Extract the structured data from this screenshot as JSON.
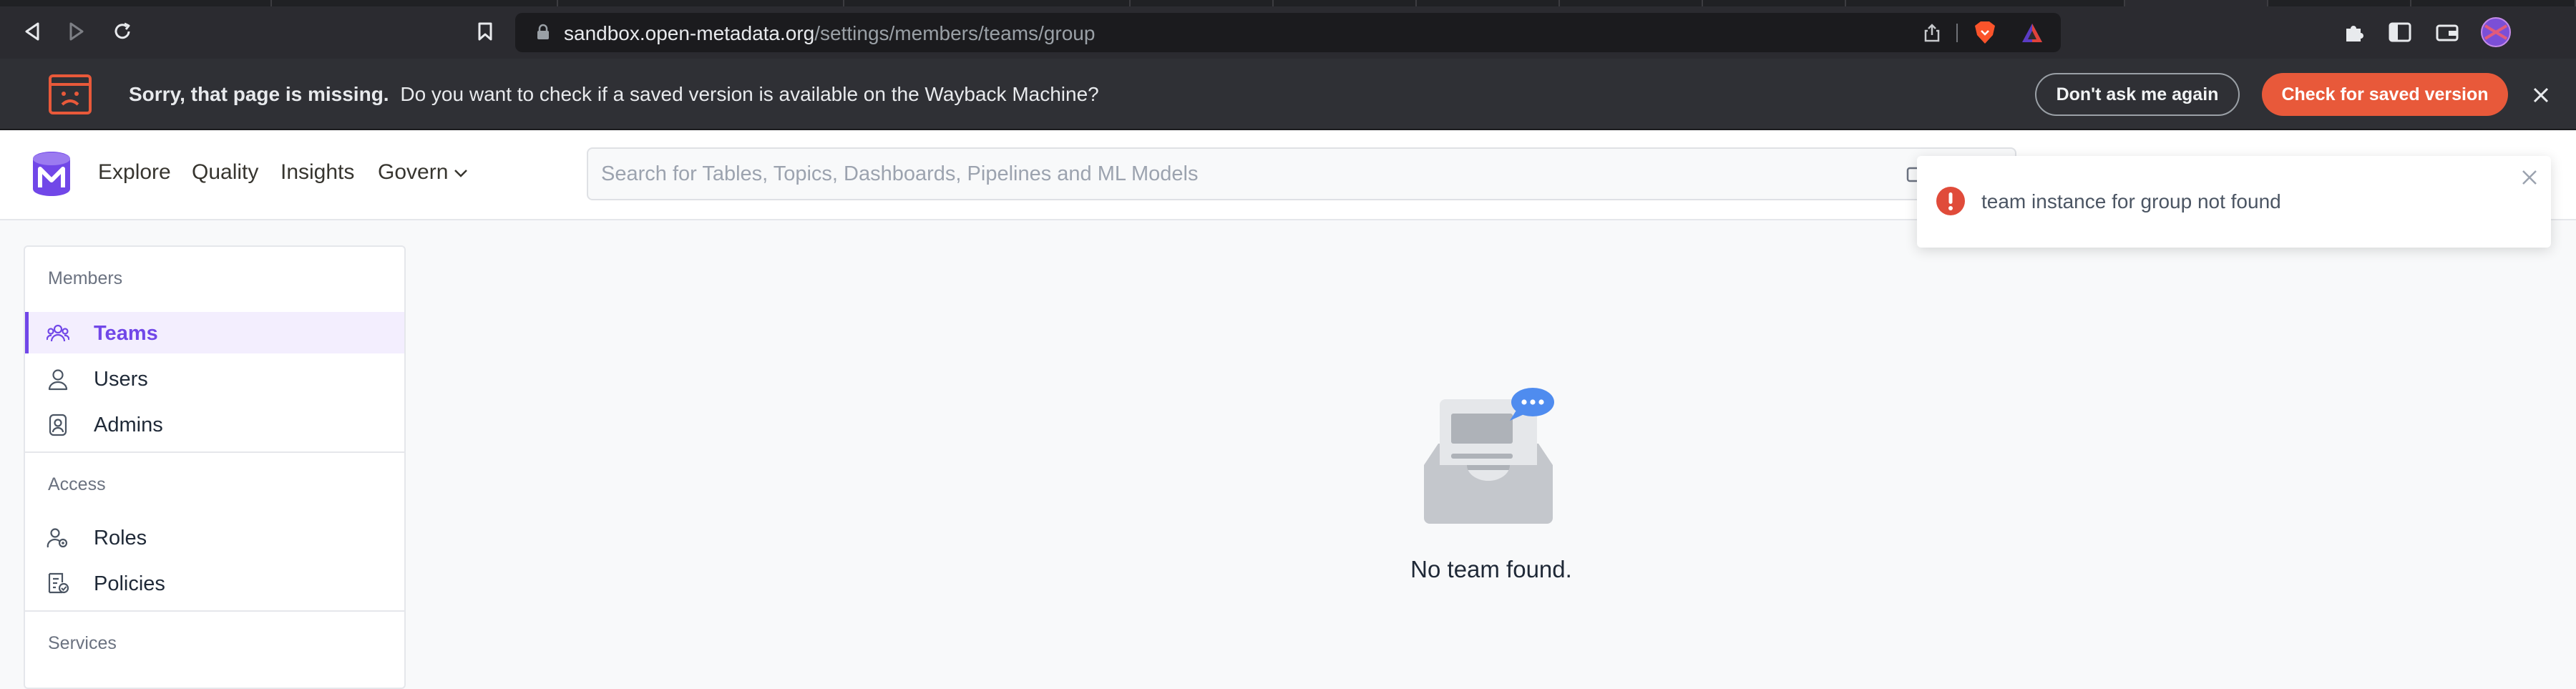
{
  "browser": {
    "url_host": "sandbox.open-metadata.org",
    "url_path": "/settings/members/teams/group"
  },
  "wayback": {
    "title": "Sorry, that page is missing.",
    "message": "Do you want to check if a saved version is available on the Wayback Machine?",
    "dont_ask_label": "Don't ask me again",
    "check_label": "Check for saved version"
  },
  "nav": {
    "items": [
      {
        "label": "Explore"
      },
      {
        "label": "Quality"
      },
      {
        "label": "Insights"
      },
      {
        "label": "Govern"
      }
    ],
    "search_placeholder": "Search for Tables, Topics, Dashboards, Pipelines and ML Models"
  },
  "sidebar": {
    "groups": [
      {
        "label": "Members"
      },
      {
        "label": "Access"
      },
      {
        "label": "Services"
      }
    ],
    "items": [
      {
        "label": "Teams",
        "icon": "teams-icon",
        "active": true
      },
      {
        "label": "Users",
        "icon": "user-icon"
      },
      {
        "label": "Admins",
        "icon": "admin-icon"
      },
      {
        "label": "Roles",
        "icon": "roles-icon"
      },
      {
        "label": "Policies",
        "icon": "policies-icon"
      }
    ]
  },
  "main": {
    "empty_message": "No team found."
  },
  "toast": {
    "message": "team instance for group not found"
  },
  "colors": {
    "accent": "#7147e8",
    "wayback_button": "#e8593a",
    "error": "#e04b3a"
  }
}
